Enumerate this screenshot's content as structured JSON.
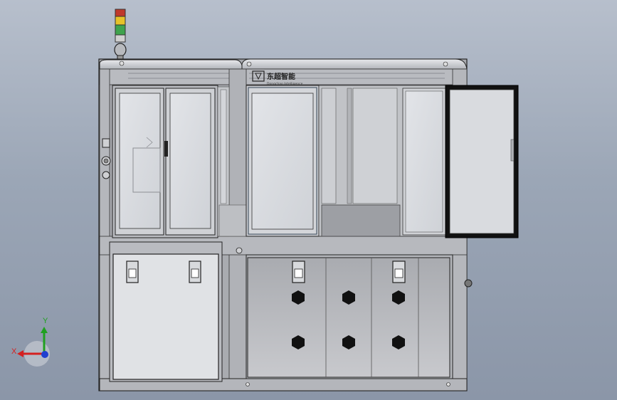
{
  "brand": {
    "name": "东超智能",
    "subtitle": "Dongchao Intelligence"
  },
  "triad": {
    "x_label": "X",
    "y_label": "Y"
  },
  "colors": {
    "background_top": "#b7bfcc",
    "background_bottom": "#8b96a8",
    "frame": "#9a9ca2",
    "panel": "#d4d6da",
    "glass": "#dcdee2",
    "door_frame": "#111111",
    "light_red": "#c0392b",
    "light_yellow": "#e6c229",
    "light_green": "#3fa34d",
    "axis_x": "#d42020",
    "axis_y": "#20a020",
    "axis_z": "#2040d0"
  },
  "icons": [
    "signal-tower-icon",
    "axis-triad-icon",
    "hex-bolt-icon",
    "door-latch-icon",
    "brand-logo-icon"
  ]
}
